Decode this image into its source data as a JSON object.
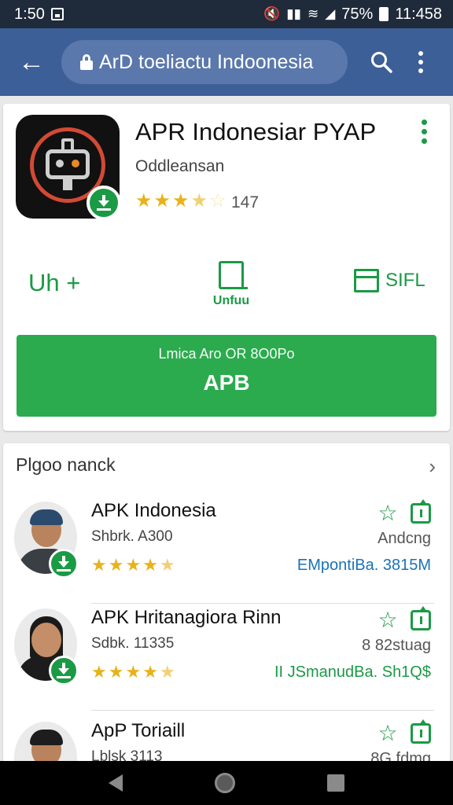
{
  "status_bar": {
    "time": "1:50",
    "battery_percent": "75%",
    "clock_right": "11:458"
  },
  "app_bar": {
    "url_text": "ArD toeliactu Indoonesia",
    "icons": [
      "back-arrow-icon",
      "lock-icon",
      "search-icon",
      "more-vert-icon"
    ]
  },
  "app": {
    "title": "APR Indonesiar PYAP",
    "developer": "Oddleansan",
    "rating": 3.5,
    "rating_count": "147",
    "actions": {
      "left_label": "Uh +",
      "mid_label": "Unfuu",
      "right_label": "SIFL"
    },
    "install": {
      "subtext": "Lmica Aro OR 8O0Po",
      "label": "APB"
    }
  },
  "list": {
    "header": "Plgoo nanck",
    "items": [
      {
        "title": "APK Indonesia",
        "subtitle": "Shbrk. A300",
        "tag": "Andcng",
        "size": "EMpontiBa. 3815M",
        "size_color": "#1a73b8",
        "rating": 4.5
      },
      {
        "title": "APK Hritanagiora Rinn",
        "subtitle": "Sdbk. 11335",
        "tag": "8 82stuag",
        "size": "II JSmanudBa. Sh1Q$",
        "size_color": "#1b9a45",
        "rating": 4.5
      },
      {
        "title": "ApP Toriaill",
        "subtitle": "Lblsk 3113",
        "tag": "8G.fdmg",
        "size": "",
        "size_color": "#1b9a45",
        "rating": 0
      }
    ]
  },
  "colors": {
    "status_bar": "#1f2a3a",
    "app_bar": "#3d5f98",
    "accent_green": "#2bab4e",
    "star": "#e8b21a"
  }
}
